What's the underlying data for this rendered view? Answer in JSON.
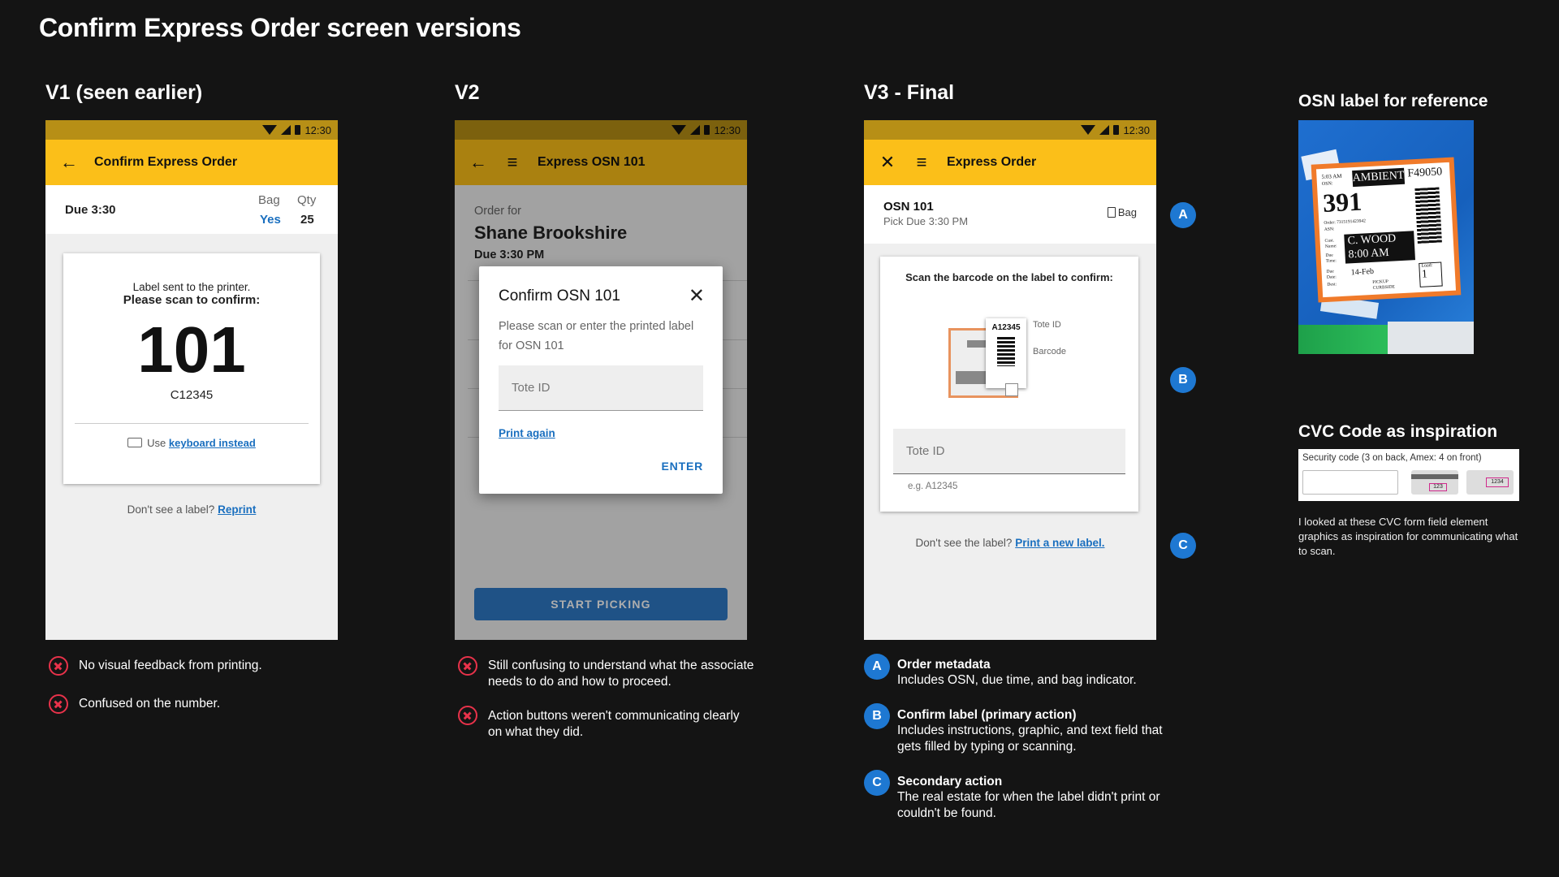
{
  "page": {
    "title": "Confirm Express Order screen versions"
  },
  "status_time": "12:30",
  "v1": {
    "title": "V1 (seen earlier)",
    "appbar_title": "Confirm Express Order",
    "due": "Due 3:30",
    "bag_label": "Bag",
    "bag_value": "Yes",
    "qty_label": "Qty",
    "qty_value": "25",
    "card_line1": "Label sent to the printer.",
    "card_line2": "Please scan to confirm:",
    "big_number": "101",
    "code": "C12345",
    "keyboard_prefix": "Use",
    "keyboard_link": "keyboard instead",
    "footer_prefix": "Don't see a label?",
    "footer_link": "Reprint",
    "notes": [
      "No visual feedback from printing.",
      "Confused on the number."
    ]
  },
  "v2": {
    "title": "V2",
    "appbar_title": "Express OSN 101",
    "order_for": "Order for",
    "customer": "Shane Brookshire",
    "due": "Due 3:30 PM",
    "dialog_title": "Confirm OSN 101",
    "dialog_text": "Please scan or enter the printed label for OSN 101",
    "tote_placeholder": "Tote ID",
    "print_again": "Print again",
    "enter": "ENTER",
    "start_picking": "START PICKING",
    "notes": [
      "Still confusing to understand what the associate needs to do and how to proceed.",
      "Action buttons weren't communicating clearly on what they did."
    ]
  },
  "v3": {
    "title": "V3 - Final",
    "appbar_title": "Express Order",
    "osn": "OSN 101",
    "pick_due": "Pick Due 3:30 PM",
    "bag": "Bag",
    "scan_instruction": "Scan the barcode on the label to confirm:",
    "label_id": "A12345",
    "tote_id_label": "Tote ID",
    "barcode_label": "Barcode",
    "tote_placeholder": "Tote ID",
    "hint": "e.g. A12345",
    "footer_prefix": "Don't see the label?",
    "footer_link": "Print a new label.",
    "badges": [
      "A",
      "B",
      "C"
    ],
    "legend": [
      {
        "letter": "A",
        "title": "Order metadata",
        "desc": "Includes OSN, due time, and bag indicator."
      },
      {
        "letter": "B",
        "title": "Confirm label (primary action)",
        "desc": "Includes instructions, graphic, and text field that gets filled by typing or scanning."
      },
      {
        "letter": "C",
        "title": "Secondary action",
        "desc": "The real estate for when the label didn't print or couldn't be found."
      }
    ]
  },
  "reference": {
    "osn_title": "OSN label for reference",
    "label_time": "5:03 AM",
    "label_osn_label": "OSN:",
    "label_type": "AMBIENT",
    "label_code": "F49050",
    "label_number": "391",
    "label_order": "Order: 7315191423942",
    "label_asn": "ASN:",
    "label_cust_label": "Cust. Name:",
    "label_name": "C. WOOD",
    "label_due_label": "Due Time:",
    "label_time2": "8:00 AM",
    "label_due_date_label": "Due Date:",
    "label_date": "14-Feb",
    "label_dest_label": "Dest:",
    "label_pickup": "PICKUP",
    "label_curbside": "CURBSIDE",
    "label_load_label": "Load:",
    "label_load": "1",
    "cvc_title": "CVC Code as inspiration",
    "cvc_label": "Security code (3 on back, Amex: 4 on front)",
    "cvc_back_digits": "123",
    "cvc_front_digits": "1234",
    "cvc_desc": "I looked at these CVC form field element graphics as inspiration for communicating what to scan."
  },
  "colors": {
    "accent_yellow": "#fbbf19",
    "badge_blue": "#1e78d2",
    "error_red": "#e8324a",
    "link_blue": "#1a6fbf"
  }
}
